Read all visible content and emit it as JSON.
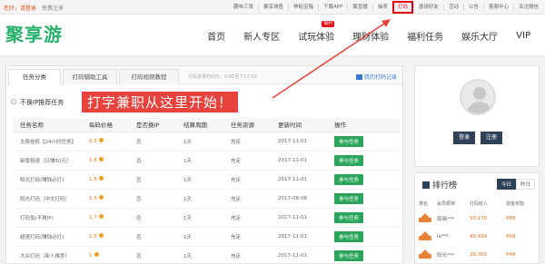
{
  "topbar": {
    "welcome": "您好，请登录",
    "register": "免费注册",
    "links": [
      "趣味三张",
      "聚享城鱼",
      "神秘宝箱",
      "下载APP",
      "聚直播",
      "抽奖",
      "打码",
      "邀请好友",
      "活动",
      "公告",
      "客服中心",
      "关注微信"
    ],
    "highlighted_link": "打码"
  },
  "header": {
    "logo": "聚享游",
    "nav": [
      "首页",
      "新人专区",
      "试玩体验",
      "理财体验",
      "福利任务",
      "娱乐大厅",
      "VIP"
    ],
    "nav_badge": "福利"
  },
  "tabs": [
    "任务分类",
    "打码辅助工具",
    "打码视频教程"
  ],
  "open_time": "打码按事时间为：9:00至下17:00",
  "my_record": "我的打码记录",
  "ip_note": "不换IP推荐任务",
  "annotation": "打字兼职从这里开始！",
  "table": {
    "headers": [
      "任务名称",
      "每码价格",
      "是否换IP",
      "结算周期",
      "任务资源",
      "更新时间",
      "操作"
    ],
    "rows": [
      {
        "name": "太极挂机【24小时任务】",
        "price": "0.5",
        "ip": "否",
        "cycle": "1天",
        "resource": "充足",
        "date": "2017-11-01",
        "action": "参与任务"
      },
      {
        "name": "新版极速（日赚50元）",
        "price": "1.6",
        "ip": "否",
        "cycle": "1天",
        "resource": "充足",
        "date": "2017-11-01",
        "action": "参与任务"
      },
      {
        "name": "阳光打码(赚钱必打)",
        "price": "1.5",
        "ip": "否",
        "cycle": "1天",
        "resource": "充足",
        "date": "2017-11-01",
        "action": "参与任务"
      },
      {
        "name": "阳光打码（中文打码）",
        "price": "1.5",
        "ip": "否",
        "cycle": "1天",
        "resource": "充足",
        "date": "2017-08-08",
        "action": "参与任务"
      },
      {
        "name": "打码兔(不换IP)",
        "price": "1.7",
        "ip": "否",
        "cycle": "1天",
        "resource": "充足",
        "date": "2017-11-01",
        "action": "参与任务"
      },
      {
        "name": "超速打码(赚钱必打)",
        "price": "1.5",
        "ip": "否",
        "cycle": "1天",
        "resource": "充足",
        "date": "2017-11-01",
        "action": "参与任务"
      },
      {
        "name": "大众打码（新人推荐）",
        "price": "1",
        "ip": "否",
        "cycle": "1天",
        "resource": "充足",
        "date": "2017-11-01",
        "action": "参与任务"
      }
    ]
  },
  "login": {
    "login_label": "登录",
    "register_label": "注册"
  },
  "ranking": {
    "title": "排行榜",
    "tabs": [
      "今日",
      "昨日"
    ],
    "headers": [
      "排名",
      "会员昵称",
      "打码收入",
      "现金奖励"
    ],
    "rows": [
      {
        "name": "琉璃***",
        "income": "50,170",
        "cash": "¥88"
      },
      {
        "name": "le***",
        "income": "40,434",
        "cash": "¥68"
      },
      {
        "name": "阳光***",
        "income": "28,300",
        "cash": "¥48"
      }
    ]
  },
  "colors": {
    "brand_green": "#25b06a",
    "action_green": "#2aa55b",
    "highlight_red": "#e60012",
    "dark_navy": "#2f4158",
    "orange": "#e66f1a"
  }
}
